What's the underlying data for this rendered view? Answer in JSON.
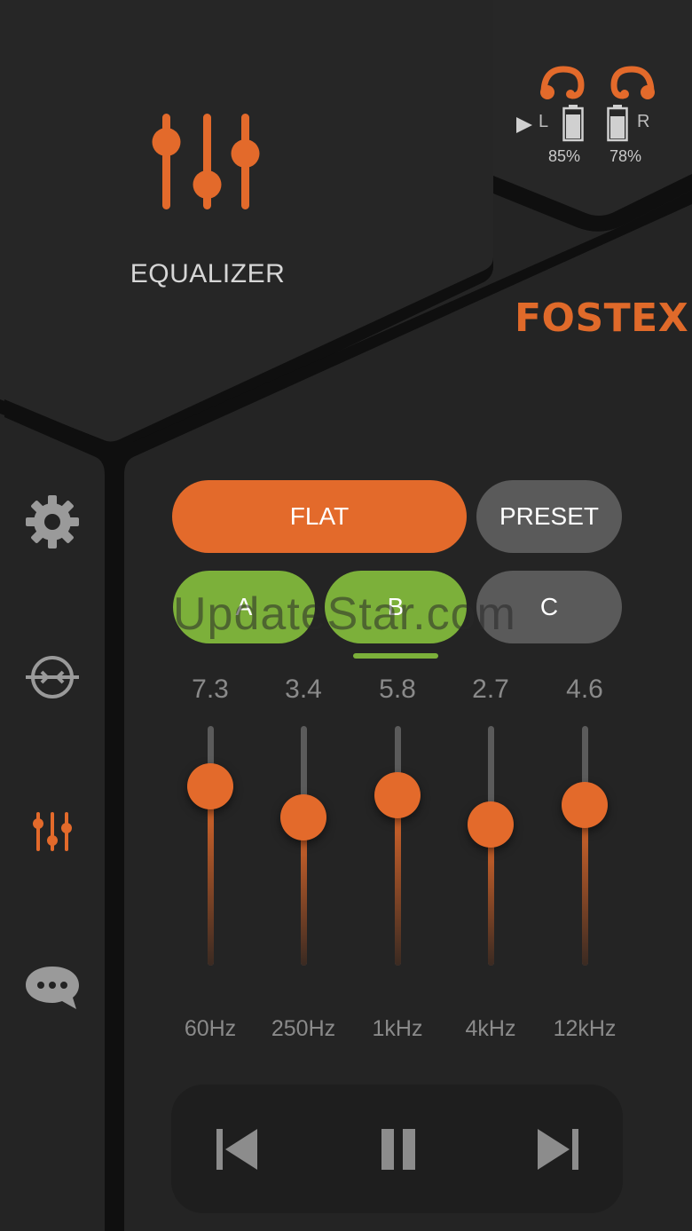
{
  "header": {
    "title": "EQUALIZER",
    "brand": "FOSTEX",
    "brand_color": "#e06a2a",
    "icon": "equalizer-icon"
  },
  "earbuds": {
    "left": {
      "side": "L",
      "battery_pct": "85%",
      "battery_level": 0.85,
      "playing": true,
      "icon": "earbud-left-icon"
    },
    "right": {
      "side": "R",
      "battery_pct": "78%",
      "battery_level": 0.78,
      "icon": "earbud-right-icon"
    }
  },
  "sidebar": {
    "items": [
      {
        "name": "settings",
        "icon": "gear-icon",
        "active": false
      },
      {
        "name": "connection",
        "icon": "connect-icon",
        "active": false
      },
      {
        "name": "equalizer",
        "icon": "equalizer-icon",
        "active": true
      },
      {
        "name": "messages",
        "icon": "chat-icon",
        "active": false
      }
    ]
  },
  "modes": {
    "flat_label": "FLAT",
    "preset_label": "PRESET",
    "a_label": "A",
    "b_label": "B",
    "c_label": "C",
    "active_mode": "FLAT",
    "active_slot": "B"
  },
  "watermark": "UpdateStar.com",
  "bands": [
    {
      "freq": "60Hz",
      "value": "7.3",
      "level": 0.75
    },
    {
      "freq": "250Hz",
      "value": "3.4",
      "level": 0.62
    },
    {
      "freq": "1kHz",
      "value": "5.8",
      "level": 0.71
    },
    {
      "freq": "4kHz",
      "value": "2.7",
      "level": 0.59
    },
    {
      "freq": "12kHz",
      "value": "4.6",
      "level": 0.67
    }
  ],
  "transport": {
    "prev_icon": "skip-previous-icon",
    "pause_icon": "pause-icon",
    "next_icon": "skip-next-icon"
  },
  "colors": {
    "accent": "#e36a2b",
    "green": "#7cb03a",
    "gray_button": "#5a5a5a"
  }
}
